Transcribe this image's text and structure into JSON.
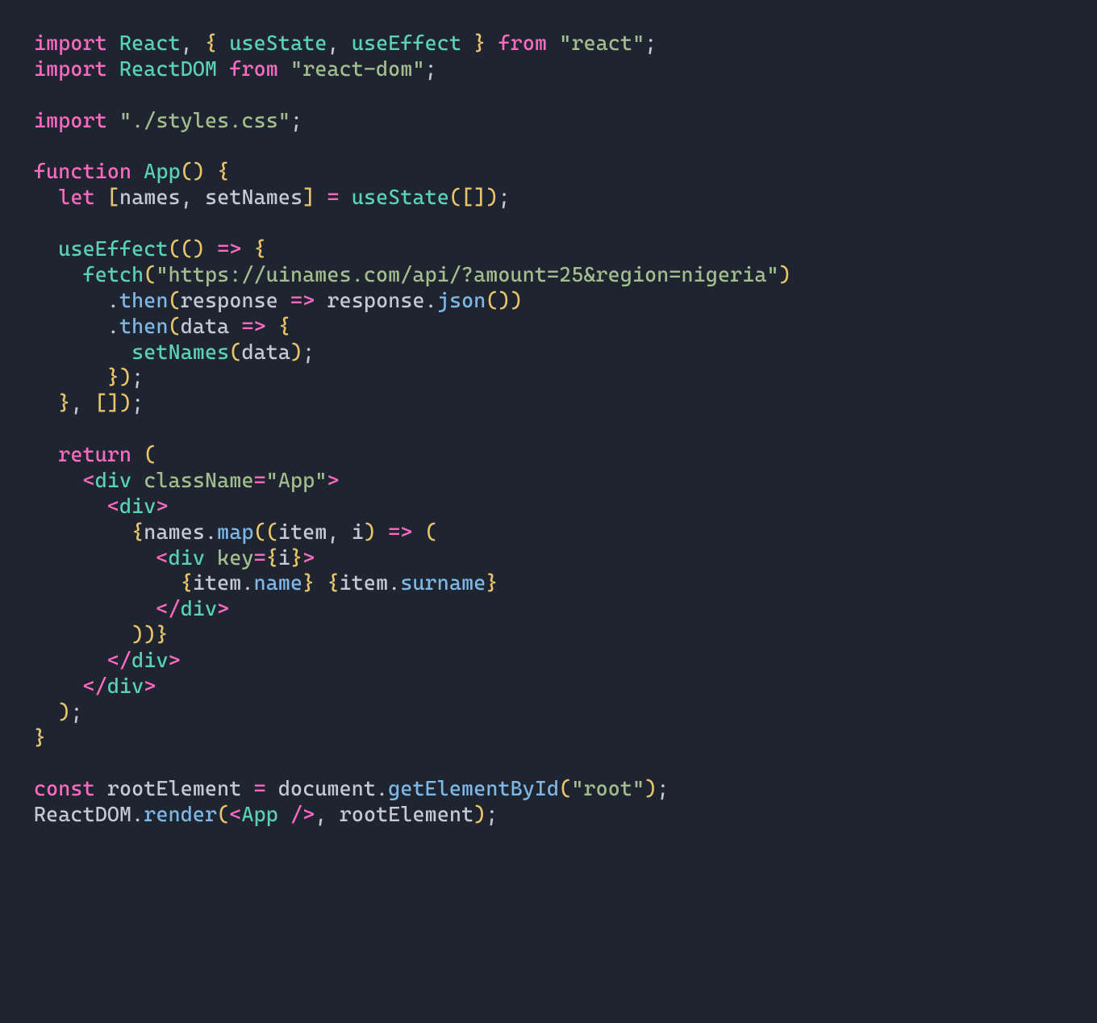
{
  "code": {
    "line1": {
      "import": "import",
      "react": "React",
      "comma1": ",",
      "lbrace": "{",
      "useState": "useState",
      "comma2": ",",
      "useEffect": "useEffect",
      "rbrace": "}",
      "from": "from",
      "reactStr": "\"react\"",
      "semi": ";"
    },
    "line2": {
      "import": "import",
      "reactdom": "ReactDOM",
      "from": "from",
      "str": "\"react-dom\"",
      "semi": ";"
    },
    "line4": {
      "import": "import",
      "str": "\"./styles.css\"",
      "semi": ";"
    },
    "line6": {
      "function": "function",
      "app": "App",
      "parens": "()",
      "lbrace": "{"
    },
    "line7": {
      "let": "let",
      "lbrack": "[",
      "names": "names",
      "comma": ",",
      "setNames": "setNames",
      "rbrack": "]",
      "eq": "=",
      "useState": "useState",
      "lparen": "(",
      "arr": "[]",
      "rparen": ")",
      "semi": ";"
    },
    "line9": {
      "useEffect": "useEffect",
      "lparen": "(",
      "parens": "()",
      "arrow": "=>",
      "lbrace": "{"
    },
    "line10": {
      "fetch": "fetch",
      "lparen": "(",
      "url": "\"https://uinames.com/api/?amount=25&region=nigeria\"",
      "rparen": ")"
    },
    "line11": {
      "dot": ".",
      "then": "then",
      "lparen": "(",
      "response": "response",
      "arrow": "=>",
      "response2": "response",
      "dot2": ".",
      "json": "json",
      "parens": "()",
      "rparen": ")"
    },
    "line12": {
      "dot": ".",
      "then": "then",
      "lparen": "(",
      "data": "data",
      "arrow": "=>",
      "lbrace": "{"
    },
    "line13": {
      "setNames": "setNames",
      "lparen": "(",
      "data": "data",
      "rparen": ")",
      "semi": ";"
    },
    "line14": {
      "rbrace": "}",
      "rparen": ")",
      "semi": ";"
    },
    "line15": {
      "rbrace": "}",
      "comma": ",",
      "arr": "[]",
      "rparen": ")",
      "semi": ";"
    },
    "line17": {
      "return": "return",
      "lparen": "("
    },
    "line18": {
      "lt": "<",
      "div": "div",
      "className": "className",
      "eq": "=",
      "app": "\"App\"",
      "gt": ">"
    },
    "line19": {
      "lt": "<",
      "div": "div",
      "gt": ">"
    },
    "line20": {
      "lbrace": "{",
      "names": "names",
      "dot": ".",
      "map": "map",
      "lparen": "(",
      "lparen2": "(",
      "item": "item",
      "comma": ",",
      "i": "i",
      "rparen": ")",
      "arrow": "=>",
      "lparen3": "("
    },
    "line21": {
      "lt": "<",
      "div": "div",
      "key": "key",
      "eq": "=",
      "lbrace": "{",
      "i": "i",
      "rbrace": "}",
      "gt": ">"
    },
    "line22": {
      "lbrace1": "{",
      "item1": "item",
      "dot1": ".",
      "name": "name",
      "rbrace1": "}",
      "space": " ",
      "lbrace2": "{",
      "item2": "item",
      "dot2": ".",
      "surname": "surname",
      "rbrace2": "}"
    },
    "line23": {
      "lt": "<",
      "slash": "/",
      "div": "div",
      "gt": ">"
    },
    "line24": {
      "rparen": ")",
      "rparen2": ")",
      "rbrace": "}"
    },
    "line25": {
      "lt": "<",
      "slash": "/",
      "div": "div",
      "gt": ">"
    },
    "line26": {
      "lt": "<",
      "slash": "/",
      "div": "div",
      "gt": ">"
    },
    "line27": {
      "rparen": ")",
      "semi": ";"
    },
    "line28": {
      "rbrace": "}"
    },
    "line30": {
      "const": "const",
      "rootElement": "rootElement",
      "eq": "=",
      "document": "document",
      "dot": ".",
      "getElementById": "getElementById",
      "lparen": "(",
      "root": "\"root\"",
      "rparen": ")",
      "semi": ";"
    },
    "line31": {
      "reactdom": "ReactDOM",
      "dot": ".",
      "render": "render",
      "lparen": "(",
      "lt": "<",
      "app": "App",
      "slash": "/",
      "gt": ">",
      "comma": ",",
      "rootElement": "rootElement",
      "rparen": ")",
      "semi": ";"
    }
  }
}
